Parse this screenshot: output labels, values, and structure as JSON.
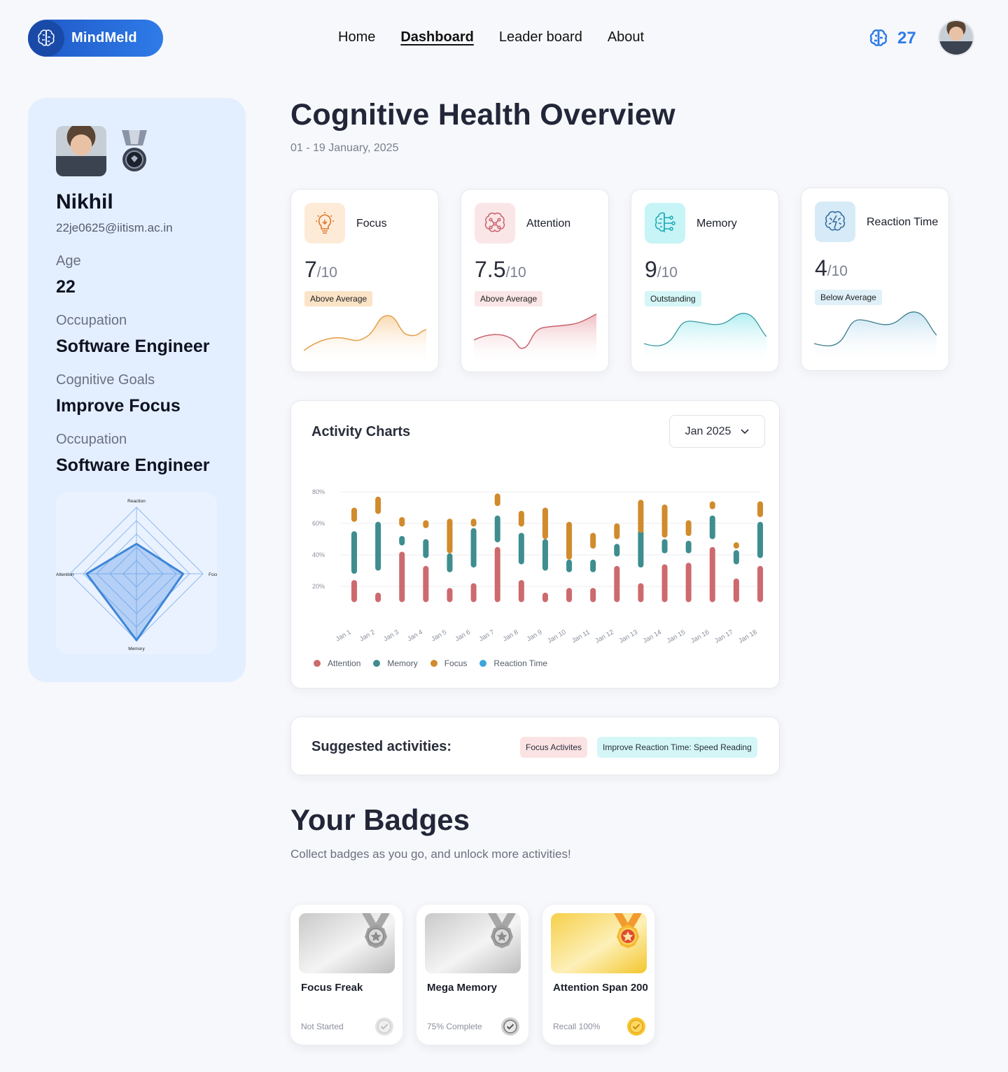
{
  "brand": {
    "name": "MindMeld"
  },
  "nav": {
    "items": [
      "Home",
      "Dashboard",
      "Leader board",
      "About"
    ],
    "active": "Dashboard"
  },
  "header": {
    "points": "27"
  },
  "profile": {
    "name": "Nikhil",
    "email": "22je0625@iitism.ac.in",
    "fields": [
      {
        "label": "Age",
        "value": "22"
      },
      {
        "label": "Occupation",
        "value": "Software Engineer"
      },
      {
        "label": "Cognitive Goals",
        "value": "Improve Focus"
      },
      {
        "label": "Occupation",
        "value": "Software Engineer"
      }
    ],
    "radar": {
      "axes": [
        "Reaction",
        "Focus",
        "Memory",
        "Attention"
      ],
      "values": [
        0.45,
        0.7,
        1.0,
        0.75
      ]
    }
  },
  "page": {
    "title": "Cognitive Health Overview",
    "date_range": "01 - 19 January, 2025"
  },
  "metrics": [
    {
      "name": "Focus",
      "score": "7",
      "max": "/10",
      "tag": "Above Average",
      "color": "#e2a04a",
      "tag_bg": "#fbe3c8",
      "icon_bg": "#fdebd7",
      "icon": "lightbulb-icon"
    },
    {
      "name": "Attention",
      "score": "7.5",
      "max": "/10",
      "tag": "Above Average",
      "color": "#c9636e",
      "tag_bg": "#fbe6e7",
      "icon_bg": "#fbe6e7",
      "icon": "brain-circuit-icon"
    },
    {
      "name": "Memory",
      "score": "9",
      "max": "/10",
      "tag": "Outstanding",
      "color": "#3dbfca",
      "tag_bg": "#d4f6f7",
      "icon_bg": "#c7f4f6",
      "icon": "brain-chip-icon"
    },
    {
      "name": "Reaction Time",
      "score": "4",
      "max": "/10",
      "tag": "Below Average",
      "color": "#4a8fb3",
      "tag_bg": "#dff0f8",
      "icon_bg": "#d7eaf7",
      "icon": "brain-lightning-icon"
    }
  ],
  "activity": {
    "title": "Activity Charts",
    "month_select": "Jan 2025",
    "legend": [
      {
        "name": "Attention",
        "color": "#cd6a6e"
      },
      {
        "name": "Memory",
        "color": "#3f8d8f"
      },
      {
        "name": "Focus",
        "color": "#d08b2c"
      },
      {
        "name": "Reaction Time",
        "color": "#3ba6dc"
      }
    ]
  },
  "chart_data": {
    "type": "bar",
    "ytick_labels": [
      "20%",
      "40%",
      "60%",
      "80%"
    ],
    "ylim": [
      0,
      80
    ],
    "categories": [
      "Jan 1",
      "Jan 2",
      "Jan 3",
      "Jan 4",
      "Jan 5",
      "Jan 6",
      "Jan 7",
      "Jan 8",
      "Jan 9",
      "Jan 10",
      "Jan 11",
      "Jan 12",
      "Jan 13",
      "Jan 14",
      "Jan 15",
      "Jan 16",
      "Jan 17",
      "Jan 18"
    ],
    "series": [
      {
        "name": "Attention",
        "ranges": [
          [
            10,
            24
          ],
          [
            10,
            16
          ],
          [
            10,
            42
          ],
          [
            10,
            33
          ],
          [
            10,
            19
          ],
          [
            10,
            22
          ],
          [
            10,
            45
          ],
          [
            10,
            24
          ],
          [
            10,
            16
          ],
          [
            10,
            19
          ],
          [
            10,
            19
          ],
          [
            10,
            33
          ],
          [
            10,
            22
          ],
          [
            10,
            34
          ],
          [
            10,
            35
          ],
          [
            10,
            45
          ],
          [
            10,
            25
          ],
          [
            10,
            33
          ]
        ]
      },
      {
        "name": "Memory",
        "ranges": [
          [
            28,
            55
          ],
          [
            30,
            61
          ],
          [
            46,
            52
          ],
          [
            38,
            50
          ],
          [
            29,
            41
          ],
          [
            32,
            57
          ],
          [
            48,
            65
          ],
          [
            34,
            54
          ],
          [
            30,
            50
          ],
          [
            29,
            37
          ],
          [
            29,
            37
          ],
          [
            39,
            47
          ],
          [
            32,
            56
          ],
          [
            41,
            50
          ],
          [
            41,
            49
          ],
          [
            50,
            65
          ],
          [
            34,
            43
          ],
          [
            38,
            61
          ]
        ]
      },
      {
        "name": "Focus",
        "ranges": [
          [
            61,
            70
          ],
          [
            66,
            77
          ],
          [
            58,
            64
          ],
          [
            57,
            62
          ],
          [
            41,
            63
          ],
          [
            58,
            63
          ],
          [
            71,
            79
          ],
          [
            58,
            68
          ],
          [
            50,
            70
          ],
          [
            37,
            61
          ],
          [
            44,
            54
          ],
          [
            50,
            60
          ],
          [
            54,
            75
          ],
          [
            51,
            72
          ],
          [
            52,
            62
          ],
          [
            69,
            74
          ],
          [
            44,
            48
          ],
          [
            64,
            74
          ]
        ]
      }
    ]
  },
  "suggested": {
    "title": "Suggested activities:",
    "chips": [
      {
        "label": "Focus Activites",
        "bg": "#fbe3e4"
      },
      {
        "label": "Improve Reaction Time: Speed Reading",
        "bg": "#d4f6f7"
      }
    ]
  },
  "badges": {
    "title": "Your Badges",
    "subtitle": "Collect badges as you go, and unlock more activities!",
    "items": [
      {
        "name": "Focus Freak",
        "status": "Not Started",
        "tier": "silver"
      },
      {
        "name": "Mega Memory",
        "status": "75% Complete",
        "tier": "silver"
      },
      {
        "name": "Attention Span 200",
        "status": "Recall 100%",
        "tier": "gold"
      }
    ]
  }
}
